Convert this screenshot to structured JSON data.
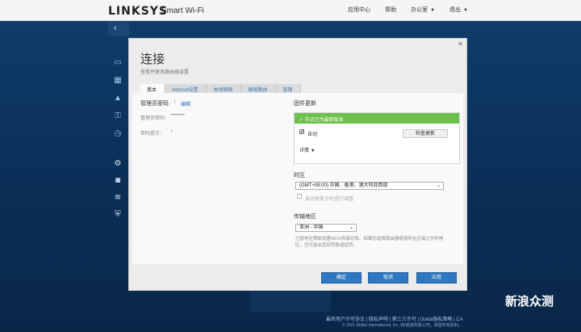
{
  "header": {
    "brand": "LINKSYS",
    "brand_sub": "Smart Wi-Fi",
    "nav": [
      "应用中心",
      "帮助",
      "办公室",
      "退出"
    ]
  },
  "rail": {
    "icons": [
      "devices-icon",
      "router-icon",
      "warning-icon",
      "key-icon",
      "clock-icon"
    ],
    "icons2": [
      "settings-icon",
      "camera-icon",
      "wifi-icon",
      "shield-icon"
    ]
  },
  "modal": {
    "title": "连接",
    "subtitle": "查看并更改路由器设置",
    "tabs": [
      "基本",
      "Internet设置",
      "本地网络",
      "高级路由",
      "管理"
    ],
    "router_password": {
      "label": "管理员密码",
      "edit": "编辑",
      "pw_label": "管理员密码：",
      "pw_value": "••••••••",
      "hint_label": "密码提示：",
      "hint_value": "t"
    },
    "firmware": {
      "heading": "固件更新",
      "status": "✓ 节点已为最新版本",
      "auto_label": "自动",
      "check_button": "检查更新",
      "details": "详情"
    },
    "timezone": {
      "heading": "时区",
      "selected": "(GMT+08:00) 中国、香港、澳大利亚西部",
      "dst_label": "自动按夏令时进行调整"
    },
    "region": {
      "heading": "传输地区",
      "selected": "亚洲 - 中国",
      "note": "已按地区限制设置Wi-Fi传输功率。如果您选择路由器使用所在区域之外的地区，您可能会受到罚款或惩罚。"
    },
    "buttons": {
      "ok": "确定",
      "cancel": "取消",
      "apply": "应用"
    }
  },
  "footer": {
    "links": "最终用户许可协议 | 隐私声明 | 第三方许可 | Ookla隐私策略 | CA",
    "copyright": "© 2021 Belkin International, Inc. 和/或其附属公司。保留所有权利。"
  },
  "watermark": "新浪众测"
}
